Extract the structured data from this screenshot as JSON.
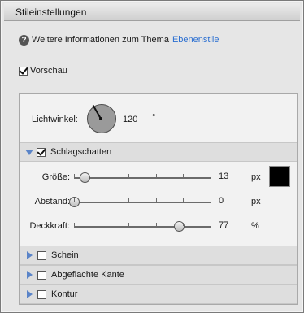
{
  "window": {
    "title": "Stileinstellungen"
  },
  "info": {
    "text": "Weitere Informationen zum Thema",
    "link": "Ebenenstile"
  },
  "preview": {
    "label": "Vorschau",
    "checked": true
  },
  "lighting": {
    "label": "Lichtwinkel:",
    "value": "120",
    "unit": "°"
  },
  "drop_shadow": {
    "label": "Schlagschatten",
    "checked": true,
    "size": {
      "label": "Größe:",
      "value": "13",
      "unit": "px",
      "fraction": 0.08
    },
    "distance": {
      "label": "Abstand:",
      "value": "0",
      "unit": "px",
      "fraction": 0.0
    },
    "opacity": {
      "label": "Deckkraft:",
      "value": "77",
      "unit": "%",
      "fraction": 0.77
    },
    "color": "#000000"
  },
  "sections": [
    {
      "label": "Schein",
      "checked": false
    },
    {
      "label": "Abgeflachte Kante",
      "checked": false
    },
    {
      "label": "Kontur",
      "checked": false
    }
  ],
  "accent": "#5a84c8",
  "link_color": "#2b6fd1"
}
